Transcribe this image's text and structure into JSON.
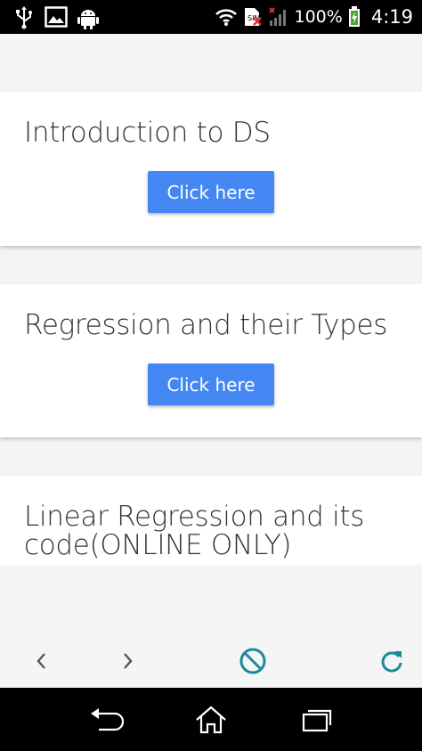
{
  "status_bar": {
    "battery": "100%",
    "time": "4:19",
    "icons": [
      "usb-icon",
      "image-icon",
      "android-icon",
      "wifi-icon",
      "sim-error-icon",
      "signal-icon",
      "battery-charging-icon"
    ]
  },
  "cards": [
    {
      "title": "Introduction to DS",
      "button_label": "Click here"
    },
    {
      "title": "Regression and their Types",
      "button_label": "Click here"
    },
    {
      "title": "Linear Regression and its code(ONLINE ONLY)"
    }
  ],
  "toolbar": {
    "icons": [
      "back-chevron-icon",
      "forward-chevron-icon",
      "stop-icon",
      "reload-icon"
    ],
    "accent_color": "#1a8a9a"
  },
  "nav_bar": {
    "icons": [
      "back-icon",
      "home-icon",
      "recent-apps-icon"
    ]
  },
  "colors": {
    "button": "#4587f2",
    "title_text": "#333333"
  }
}
